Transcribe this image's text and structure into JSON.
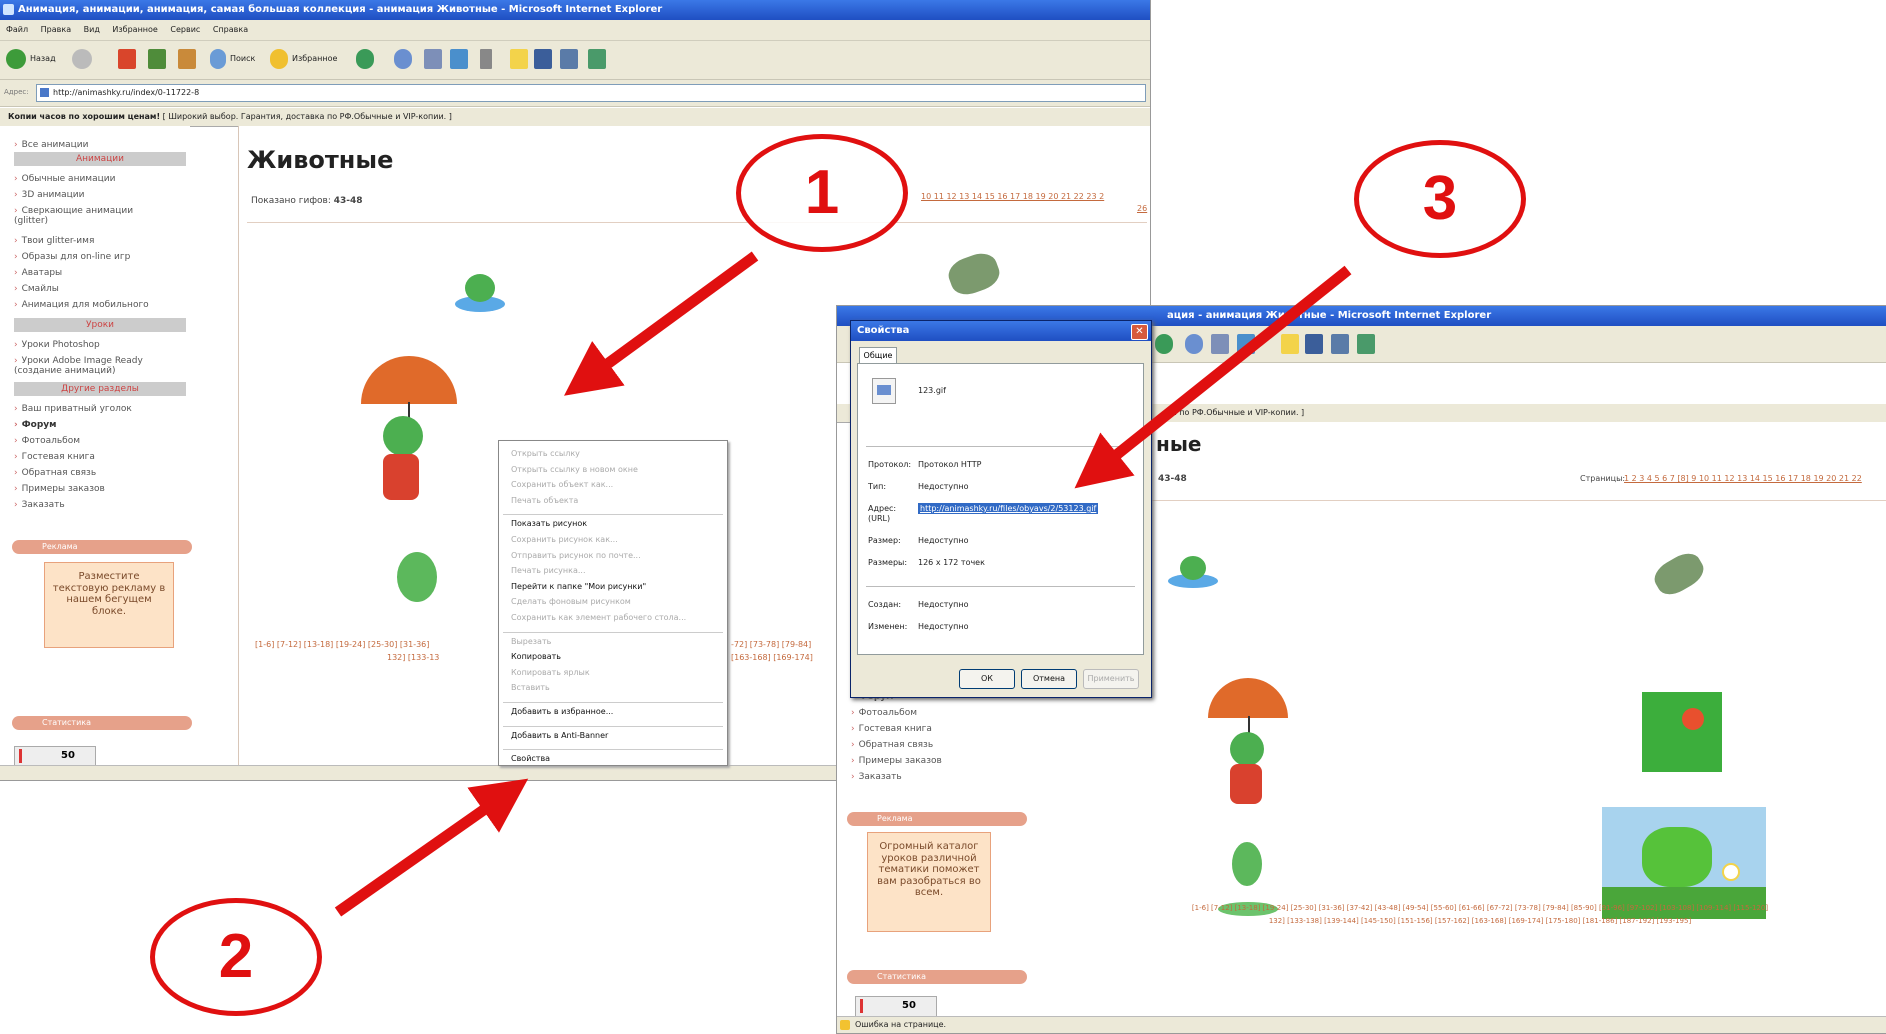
{
  "window1": {
    "title": "Анимация, анимации, анимация, самая большая коллекция - анимация Животные - Microsoft Internet Explorer",
    "menu": [
      "Файл",
      "Правка",
      "Вид",
      "Избранное",
      "Сервис",
      "Справка"
    ],
    "toolbar": {
      "back": "Назад",
      "search": "Поиск",
      "favorites": "Избранное"
    },
    "address_label": "Адрес:",
    "address": "http://animashky.ru/index/0-11722-8",
    "banner_bold": "Копии часов по хорошим ценам!",
    "banner_text": "[ Широкий выбор. Гарантия, доставка по РФ.Обычные и VIP-копии. ]",
    "sidebar": {
      "top_links": [
        "Все анимации"
      ],
      "section_animations": "Анимации",
      "animation_links": [
        "Обычные анимации",
        "3D анимации",
        "Сверкающие анимации (glitter)",
        "Твои glitter-имя",
        "Образы для on-line игр",
        "Аватары",
        "Смайлы",
        "Анимация для мобильного"
      ],
      "section_lessons": "Уроки",
      "lesson_links": [
        "Уроки Photoshop",
        "Уроки Adobe Image Ready (создание анимаций)"
      ],
      "section_other": "Другие разделы",
      "other_links": [
        "Ваш приватный уголок",
        "Форум",
        "Фотоальбом",
        "Гостевая книга",
        "Обратная связь",
        "Примеры заказов",
        "Заказать"
      ],
      "ad_header": "Реклама",
      "ad_text": "Разместите текстовую рекламу в нашем бегущем блоке.",
      "stats_header": "Статистика",
      "counter_value": "50"
    },
    "content": {
      "heading": "Животные",
      "shown_label": "Показано гифов:",
      "shown_range": "43-48",
      "page_numbers": "10 11 12 13 14 15 16 17 18 19 20 21 22 23 2",
      "page_numbers_line2": "26",
      "range_links_line1": "[1-6] [7-12] [13-18] [19-24] [25-30] [31-36]",
      "range_links_line2": "132] [133-13",
      "range_links_right1": "-72] [73-78] [79-84]",
      "range_links_right2": "[163-168] [169-174]"
    },
    "context_menu": [
      {
        "label": "Открыть ссылку",
        "enabled": false
      },
      {
        "label": "Открыть ссылку в новом окне",
        "enabled": false
      },
      {
        "label": "Сохранить объект как...",
        "enabled": false
      },
      {
        "label": "Печать объекта",
        "enabled": false
      },
      {
        "sep": true
      },
      {
        "label": "Показать рисунок",
        "enabled": true
      },
      {
        "label": "Сохранить рисунок как...",
        "enabled": false
      },
      {
        "label": "Отправить рисунок по почте...",
        "enabled": false
      },
      {
        "label": "Печать рисунка...",
        "enabled": false
      },
      {
        "label": "Перейти к папке \"Мои рисунки\"",
        "enabled": true
      },
      {
        "label": "Сделать фоновым рисунком",
        "enabled": false
      },
      {
        "label": "Сохранить как элемент рабочего стола...",
        "enabled": false
      },
      {
        "sep": true
      },
      {
        "label": "Вырезать",
        "enabled": false
      },
      {
        "label": "Копировать",
        "enabled": true
      },
      {
        "label": "Копировать ярлык",
        "enabled": false
      },
      {
        "label": "Вставить",
        "enabled": false
      },
      {
        "sep": true
      },
      {
        "label": "Добавить в избранное...",
        "enabled": true
      },
      {
        "sep": true
      },
      {
        "label": "Добавить в Anti-Banner",
        "enabled": true
      },
      {
        "sep": true
      },
      {
        "label": "Свойства",
        "enabled": true
      }
    ]
  },
  "window2": {
    "title_fragment": "ация - анимация Животные - Microsoft Internet Explorer",
    "banner_fragment": "ка по РФ.Обычные и VIP-копии. ]",
    "heading_fragment": "ные",
    "shown_range": "43-48",
    "pages_label": "Страницы:",
    "page_numbers": "1 2 3 4 5 6 7 [8] 9 10 11 12 13 14 15 16 17 18 19 20 21 22",
    "range_links_line1": "[1-6] [7-12] [13-18] [19-24] [25-30] [31-36] [37-42] [43-48] [49-54] [55-60] [61-66] [67-72] [73-78] [79-84] [85-90] [91-96] [97-102] [103-108] [109-114] [115-120]",
    "range_links_line2": "132] [133-138] [139-144] [145-150] [151-156] [157-162] [163-168] [169-174] [175-180] [181-186] [187-192] [193-195]",
    "sidebar_links": [
      "Форум",
      "Фотоальбом",
      "Гостевая книга",
      "Обратная связь",
      "Примеры заказов",
      "Заказать"
    ],
    "ad_header": "Реклама",
    "ad_text": "Огромный каталог уроков различной тематики поможет вам разобраться во всем.",
    "stats_header": "Статистика",
    "counter_value": "50",
    "status": "Ошибка на странице."
  },
  "dialog": {
    "title": "Свойства",
    "tab": "Общие",
    "filename": "123.gif",
    "protocol_label": "Протокол:",
    "protocol_value": "Протокол HTTP",
    "type_label": "Тип:",
    "type_value": "Недоступно",
    "address_label": "Адрес:",
    "address_label2": "(URL)",
    "address_value": "http://animashky.ru/files/obyavs/2/53123.gif",
    "size_label": "Размер:",
    "size_value": "Недоступно",
    "dims_label": "Размеры:",
    "dims_value": "126 x 172 точек",
    "created_label": "Создан:",
    "created_value": "Недоступно",
    "modified_label": "Изменен:",
    "modified_value": "Недоступно",
    "ok": "ОК",
    "cancel": "Отмена",
    "apply": "Применить"
  },
  "callouts": [
    "1",
    "2",
    "3"
  ],
  "accent_color": "#e01010"
}
